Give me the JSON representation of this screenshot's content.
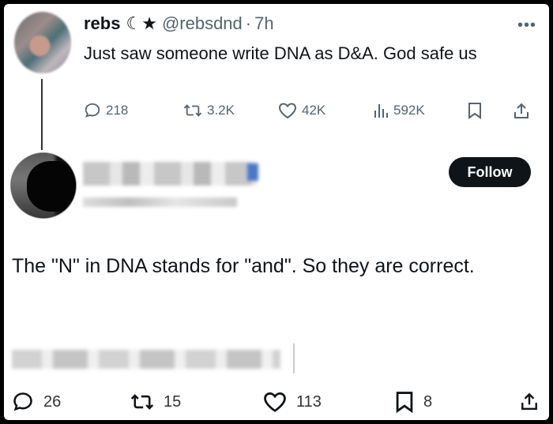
{
  "original_tweet": {
    "display_name": "rebs",
    "name_glyphs": "☾★",
    "handle": "@rebsdnd",
    "separator": "·",
    "time": "7h",
    "text": "Just saw someone write DNA as D&A. God safe us",
    "more_icon": "more-horizontal-icon",
    "stats": {
      "replies": "218",
      "reposts": "3.2K",
      "likes": "42K",
      "views": "592K"
    }
  },
  "reply_tweet": {
    "follow_label": "Follow",
    "text": "The \"N\" in DNA stands for \"and\". So they are correct.",
    "stats": {
      "replies": "26",
      "reposts": "15",
      "likes": "113",
      "bookmarks": "8"
    }
  },
  "colors": {
    "text": "#0f1419",
    "secondary": "#536471",
    "follow_bg": "#0f1419",
    "follow_text": "#ffffff"
  }
}
